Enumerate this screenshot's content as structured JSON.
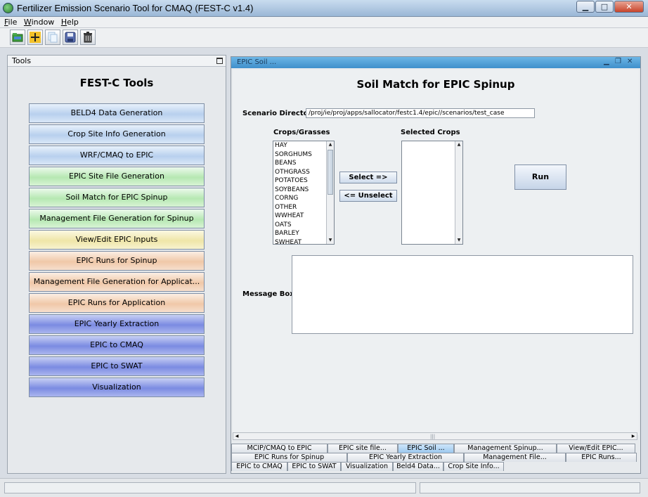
{
  "window": {
    "title": "Fertilizer Emission Scenario Tool for CMAQ (FEST-C v1.4)"
  },
  "menu": [
    "File",
    "Window",
    "Help"
  ],
  "toolbar": {
    "icons": [
      "open-folder-icon",
      "add-icon",
      "copy-icon",
      "save-icon",
      "delete-icon"
    ]
  },
  "tools_panel": {
    "header": "Tools",
    "title": "FEST-C Tools",
    "buttons": [
      {
        "label": "BELD4 Data Generation",
        "color": "#b8d0ee"
      },
      {
        "label": "Crop Site Info Generation",
        "color": "#b8d0ee"
      },
      {
        "label": "WRF/CMAQ to EPIC",
        "color": "#b8d0ee"
      },
      {
        "label": "EPIC Site File Generation",
        "color": "#b6e8b2"
      },
      {
        "label": "Soil Match for EPIC Spinup",
        "color": "#b6e8b2"
      },
      {
        "label": "Management File Generation for Spinup",
        "color": "#b6e8b2"
      },
      {
        "label": "View/Edit EPIC Inputs",
        "color": "#efe6a8"
      },
      {
        "label": "EPIC Runs for Spinup",
        "color": "#f0c8a8"
      },
      {
        "label": "Management File Generation for Applicat...",
        "color": "#f0c8a8"
      },
      {
        "label": "EPIC Runs for Application",
        "color": "#f0c8a8"
      },
      {
        "label": "EPIC Yearly Extraction",
        "color": "#7b8be2"
      },
      {
        "label": "EPIC to CMAQ",
        "color": "#7b8be2"
      },
      {
        "label": "EPIC to SWAT",
        "color": "#7b8be2"
      },
      {
        "label": "Visualization",
        "color": "#7b8be2"
      }
    ]
  },
  "frame": {
    "title": "EPIC Soil ...",
    "heading": "Soil Match for EPIC Spinup",
    "scenario_label": "Scenario Directory:",
    "scenario_value": "/proj/ie/proj/apps/sallocator/festc1.4/epic//scenarios/test_case",
    "crops_label": "Crops/Grasses",
    "selected_label": "Selected Crops",
    "crops": [
      "HAY",
      "SORGHUMS",
      "BEANS",
      "OTHGRASS",
      "POTATOES",
      "SOYBEANS",
      "CORNG",
      "OTHER",
      "WWHEAT",
      "OATS",
      "BARLEY",
      "SWHEAT"
    ],
    "selected_crops": [],
    "select_button": "Select =>",
    "unselect_button": "<= Unselect",
    "run_button": "Run",
    "message_label": "Message Box:"
  },
  "tabs": {
    "row1": [
      "MCIP/CMAQ to EPIC",
      "EPIC site file...",
      "EPIC Soil ...",
      "Management Spinup...",
      "View/Edit EPIC..."
    ],
    "row2": [
      "EPIC Runs for Spinup",
      "EPIC Yearly Extraction",
      "Management File...",
      "EPIC Runs..."
    ],
    "row3": [
      "EPIC to CMAQ",
      "EPIC to SWAT",
      "Visualization",
      "Beld4 Data...",
      "Crop Site Info..."
    ],
    "active": "EPIC Soil ..."
  }
}
